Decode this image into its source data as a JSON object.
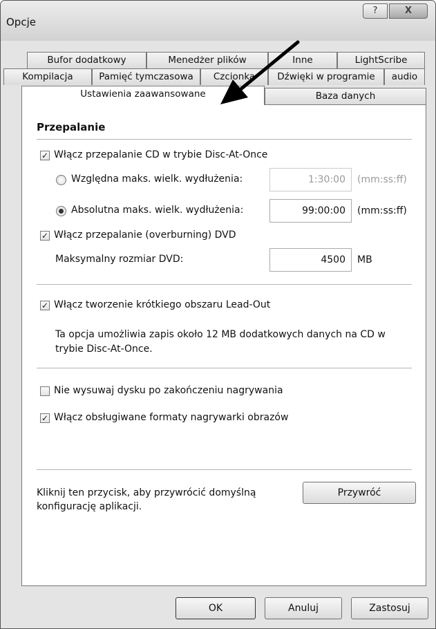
{
  "window": {
    "title": "Opcje",
    "help_label": "?",
    "close_label": "X"
  },
  "tabs": {
    "row1": [
      "Bufor dodatkowy",
      "Menedżer plików",
      "Inne",
      "LightScribe"
    ],
    "row2": [
      "Kompilacja",
      "Pamięć tymczasowa",
      "Czcionka",
      "Dźwięki w programie",
      "audio"
    ],
    "row3": [
      "Ustawienia zaawansowane",
      "Baza danych"
    ],
    "active": "Ustawienia zaawansowane"
  },
  "section": {
    "title": "Przepalanie"
  },
  "options": {
    "dao_overburn": {
      "label": "Włącz przepalanie CD w trybie Disc-At-Once",
      "checked": true
    },
    "relative_radio": {
      "label": "Względna maks. wielk. wydłużenia:",
      "value": "1:30:00",
      "unit": "(mm:ss:ff)",
      "selected": false
    },
    "absolute_radio": {
      "label": "Absolutna maks. wielk. wydłużenia:",
      "value": "99:00:00",
      "unit": "(mm:ss:ff)",
      "selected": true
    },
    "dvd_overburn": {
      "label": "Włącz przepalanie (overburning) DVD",
      "checked": true
    },
    "max_dvd": {
      "label": "Maksymalny rozmiar DVD:",
      "value": "4500",
      "unit": "MB"
    },
    "leadout": {
      "label": "Włącz tworzenie krótkiego obszaru Lead-Out",
      "checked": true
    },
    "leadout_desc_1": "Ta opcja umożliwia zapis około 12 MB dodatkowych danych na CD w",
    "leadout_desc_2": "trybie Disc-At-Once.",
    "no_eject": {
      "label": "Nie wysuwaj dysku po zakończeniu nagrywania",
      "checked": false
    },
    "image_formats": {
      "label": "Włącz obsługiwane formaty nagrywarki obrazów",
      "checked": true
    }
  },
  "restore": {
    "text_1": "Kliknij ten przycisk, aby przywrócić domyślną",
    "text_2": "konfigurację aplikacji.",
    "button": "Przywróć"
  },
  "footer": {
    "ok": "OK",
    "cancel": "Anuluj",
    "apply": "Zastosuj"
  },
  "check_mark": "✓"
}
